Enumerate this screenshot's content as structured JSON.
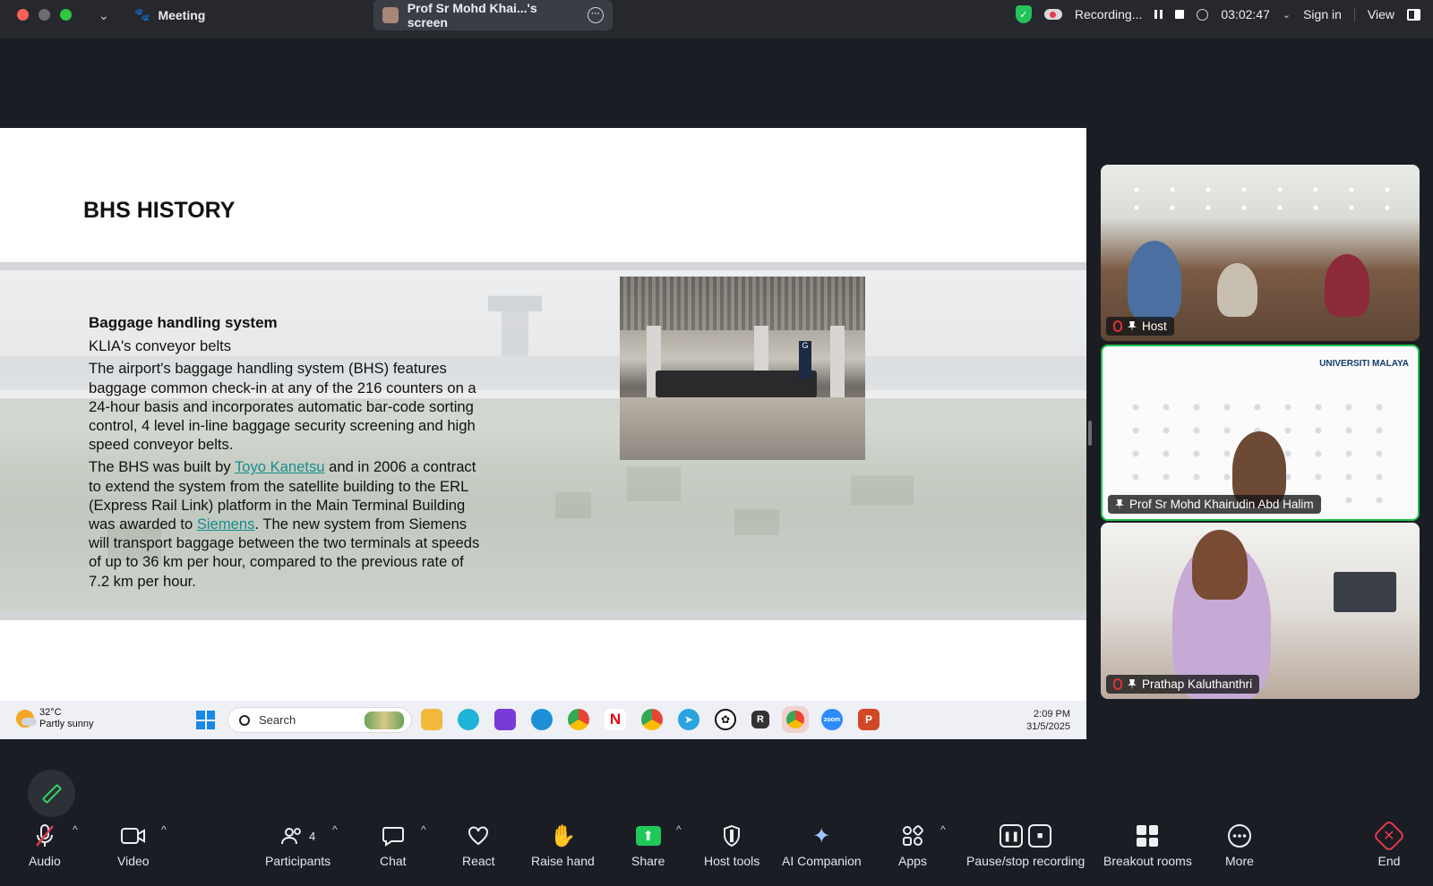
{
  "topbar": {
    "meeting_label": "Meeting",
    "screen_title": "Prof Sr Mohd Khai...'s screen",
    "recording_label": "Recording...",
    "timer": "03:02:47",
    "sign_in": "Sign in",
    "view": "View"
  },
  "slide": {
    "title": "BHS HISTORY",
    "heading": "Baggage handling system",
    "subheading": "KLIA's conveyor belts",
    "para1": "The airport's baggage handling system (BHS) features baggage common check-in at any of the 216 counters on a 24-hour basis and incorporates automatic bar-code sorting control, 4 level in-line baggage security screening and high speed conveyor belts.",
    "para2_a": "The BHS was built by ",
    "link1": "Toyo Kanetsu",
    "para2_b": " and in 2006 a contract to extend the system from the satellite building to the ERL (Express Rail Link) platform in the Main Terminal Building was awarded to ",
    "link2": "Siemens",
    "para2_c": ". The new system from Siemens will transport baggage between the two terminals at speeds of up to 36 km per hour, compared to the previous rate of 7.2 km per hour.",
    "photo_sign": "G"
  },
  "wintaskbar": {
    "temp": "32°C",
    "weather": "Partly sunny",
    "search_placeholder": "Search",
    "time": "2:09 PM",
    "date": "31/5/2025"
  },
  "participants": [
    {
      "name": "Host"
    },
    {
      "name": "Prof Sr Mohd Khairudin Abd Halim",
      "logo": "UNIVERSITI MALAYA"
    },
    {
      "name": "Prathap Kaluthanthri"
    }
  ],
  "toolbar": {
    "audio": "Audio",
    "video": "Video",
    "participants": "Participants",
    "participants_count": "4",
    "chat": "Chat",
    "react": "React",
    "raise_hand": "Raise hand",
    "share": "Share",
    "host_tools": "Host tools",
    "ai_companion": "AI Companion",
    "apps": "Apps",
    "pause_stop": "Pause/stop recording",
    "breakout": "Breakout rooms",
    "more": "More",
    "end": "End"
  },
  "colors": {
    "accent_green": "#23c04c",
    "end_red": "#e53950",
    "link_teal": "#1a8c8f"
  }
}
